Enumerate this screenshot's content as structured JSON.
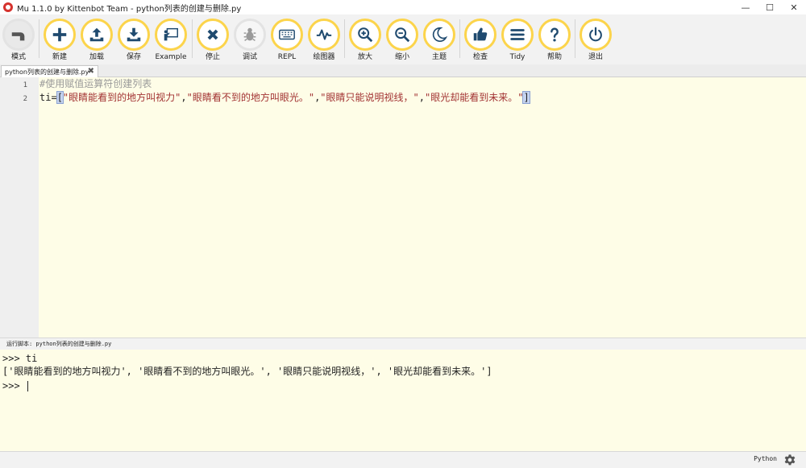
{
  "window": {
    "title": "Mu 1.1.0 by Kittenbot Team - python列表的创建与删除.py",
    "minimize": "—",
    "maximize": "☐",
    "close": "✕"
  },
  "toolbar": {
    "buttons": [
      {
        "label": "模式",
        "icon": "mode-icon"
      },
      {
        "label": "新建",
        "icon": "plus-icon"
      },
      {
        "label": "加载",
        "icon": "upload-icon"
      },
      {
        "label": "保存",
        "icon": "download-icon"
      },
      {
        "label": "Example",
        "icon": "presentation-icon"
      },
      {
        "label": "停止",
        "icon": "x-icon"
      },
      {
        "label": "调试",
        "icon": "bug-icon"
      },
      {
        "label": "REPL",
        "icon": "keyboard-icon"
      },
      {
        "label": "绘图器",
        "icon": "pulse-icon"
      },
      {
        "label": "放大",
        "icon": "zoom-in-icon"
      },
      {
        "label": "缩小",
        "icon": "zoom-out-icon"
      },
      {
        "label": "主题",
        "icon": "moon-icon"
      },
      {
        "label": "检查",
        "icon": "thumbs-up-icon"
      },
      {
        "label": "Tidy",
        "icon": "lines-icon"
      },
      {
        "label": "帮助",
        "icon": "question-icon"
      },
      {
        "label": "退出",
        "icon": "power-icon"
      }
    ]
  },
  "tabs": [
    {
      "label": "python列表的创建与删除.py",
      "close": "✖"
    }
  ],
  "editor": {
    "line_numbers": [
      "1",
      "2"
    ],
    "line1_comment": "#使用赋值运算符创建列表",
    "line2": {
      "prefix": "ti=",
      "open_bracket": "[",
      "s1": "\"眼睛能看到的地方叫视力\"",
      "comma1": ",",
      "s2": "\"眼睛看不到的地方叫眼光。\"",
      "comma2": ",",
      "s3": "\"眼睛只能说明视线，\"",
      "comma3": ",",
      "s4": "\"眼光却能看到未来。\"",
      "close_bracket": "]"
    }
  },
  "runner": {
    "label": "运行脚本: python列表的创建与删除.py"
  },
  "repl": {
    "line1": ">>> ti",
    "line2": "['眼睛能看到的地方叫视力', '眼睛看不到的地方叫眼光。', '眼睛只能说明视线，', '眼光却能看到未来。']",
    "line3": ">>> "
  },
  "status": {
    "mode": "Python"
  },
  "colors": {
    "accent_ring": "#fcd44b",
    "icon": "#1f4a6f",
    "editor_bg": "#fefde7"
  }
}
